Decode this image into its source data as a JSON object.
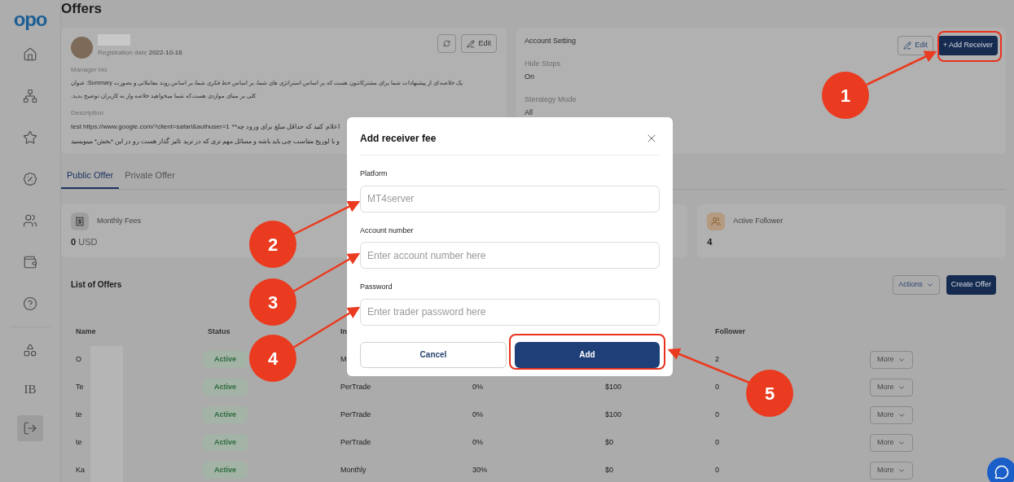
{
  "sidebar": {
    "logo": "opo",
    "items": [
      {
        "selected": false
      },
      {
        "selected": false
      },
      {
        "selected": false
      },
      {
        "selected": false
      },
      {
        "selected": false
      },
      {
        "selected": false
      },
      {
        "selected": false
      }
    ],
    "lower_items": [
      {
        "kind": "icon",
        "selected": false
      },
      {
        "kind": "text",
        "label": "IB",
        "selected": false
      },
      {
        "kind": "icon",
        "selected": true
      }
    ]
  },
  "page_title": "Offers",
  "profile": {
    "registration_label": "Registration date",
    "registration_date": "2022-10-16",
    "edit": "Edit",
    "bio_label": "Manager bio",
    "bio_lines": [
      "یک خلاصه ای از پیشنهادات شما برای مشترکانتون هست که بر اساس استراتژی های شما، بر اساس خط فکری شما، بر اساس روند معاملاتی و بصورت Summary: عنوان",
      "کلی بر مبنای مواردی هست که شما میخواهید خلاصه وار به کاربران توضیح بدید."
    ],
    "description_label": "Description",
    "description_link": "test https://www.google.com/?client=safari&authuser=1",
    "description_lines": [
      "اعلام کنید که حداقل مبلغ برای ورود چه**",
      "و با لوریج متناسب چی باید باشه و مسائل مهم تری که در ترید تاثیر گذار هست رو در این *بخش* مینویسید"
    ]
  },
  "account": {
    "title": "Account Setting",
    "edit": "Edit",
    "add_receiver": "+ Add Receiver",
    "settings": [
      {
        "label": "Hide Stops",
        "value": "On"
      },
      {
        "label": "Sterategy Mode",
        "value": "All"
      }
    ]
  },
  "tabs": [
    {
      "label": "Public Offer",
      "selected": true
    },
    {
      "label": "Private Offer",
      "selected": false
    }
  ],
  "stats": [
    {
      "label": "Monthly Fees",
      "value": "0",
      "unit": "USD"
    },
    {
      "label": "Active Follower",
      "value": "4"
    }
  ],
  "offers": {
    "title": "List of Offers",
    "actions": "Actions",
    "create": "Create Offer",
    "columns": [
      "Name",
      "Status",
      "In",
      "Follower"
    ],
    "rows": [
      {
        "name": "O",
        "status": "Active",
        "type": "M",
        "follower": "2",
        "action": "More"
      },
      {
        "name": "Te",
        "status": "Active",
        "type": "PerTrade",
        "percent": "0%",
        "price": "$100",
        "follower": "0",
        "action": "More"
      },
      {
        "name": "te",
        "status": "Active",
        "type": "PerTrade",
        "percent": "0%",
        "price": "$100",
        "follower": "0",
        "action": "More"
      },
      {
        "name": "te",
        "status": "Active",
        "type": "PerTrade",
        "percent": "0%",
        "price": "$0",
        "follower": "0",
        "action": "More"
      },
      {
        "name": "Ka",
        "status": "Active",
        "type": "Monthly",
        "percent": "30%",
        "price": "$0",
        "follower": "0",
        "action": "More"
      }
    ]
  },
  "modal": {
    "title": "Add receiver fee",
    "fields": [
      {
        "label": "Platform",
        "placeholder": "MT4server"
      },
      {
        "label": "Account number",
        "placeholder": "Enter account number here"
      },
      {
        "label": "Password",
        "placeholder": "Enter trader password here"
      }
    ],
    "cancel": "Cancel",
    "submit": "Add"
  },
  "annotations": [
    "1",
    "2",
    "3",
    "4",
    "5"
  ]
}
